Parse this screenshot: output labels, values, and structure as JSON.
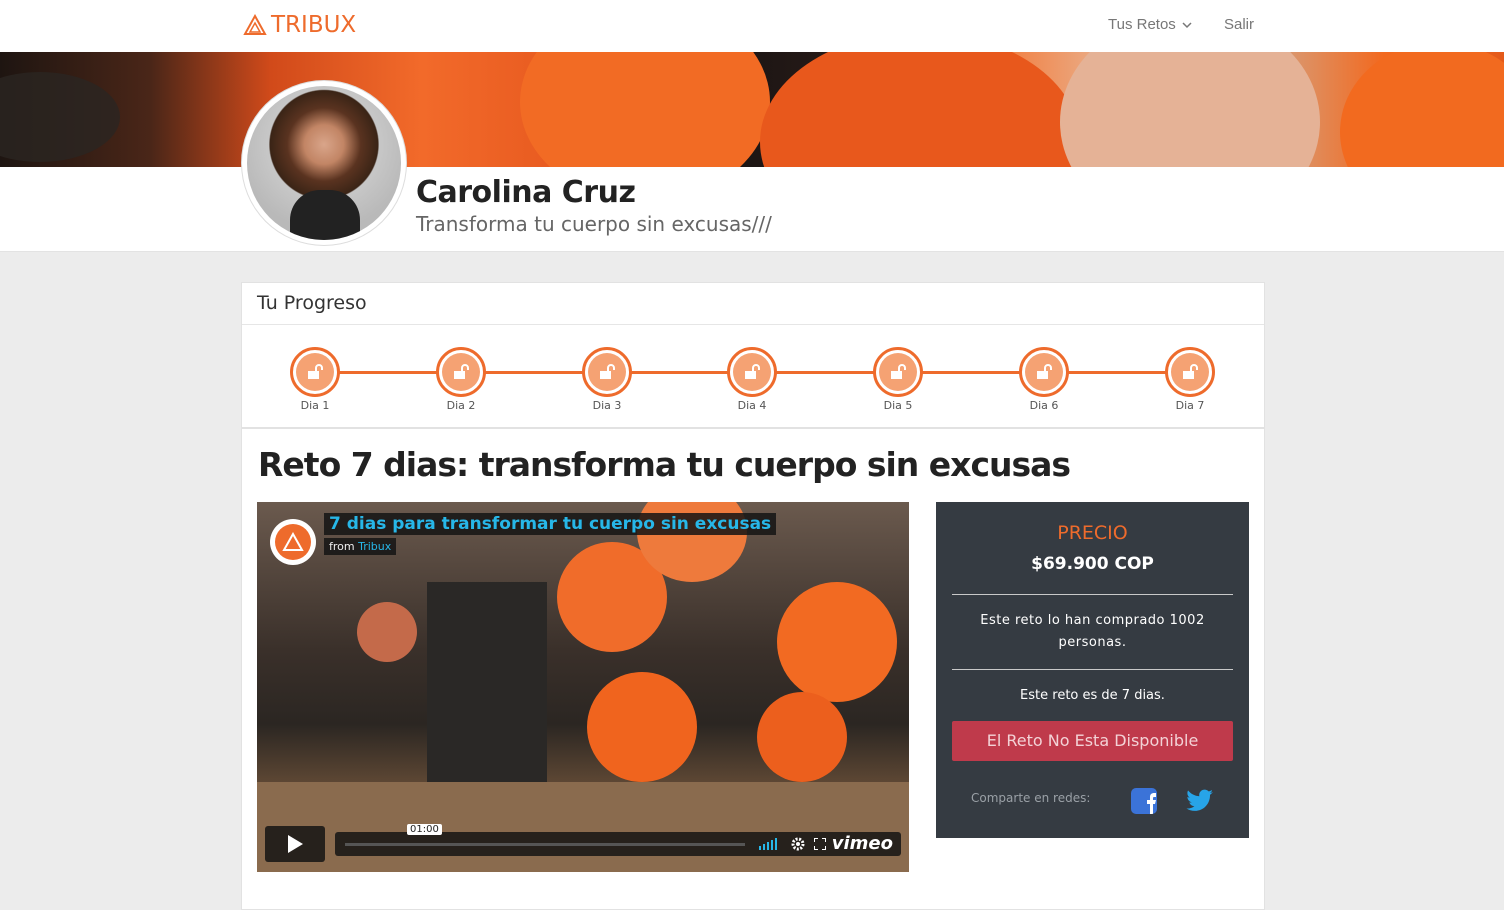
{
  "nav": {
    "brand": "TRIBUX",
    "menu_label": "Tus Retos",
    "logout_label": "Salir"
  },
  "profile": {
    "name": "Carolina Cruz",
    "tagline": "Transforma tu cuerpo sin excusas///"
  },
  "progress": {
    "heading": "Tu Progreso",
    "days": [
      "Dia 1",
      "Dia 2",
      "Dia 3",
      "Dia 4",
      "Dia 5",
      "Dia 6",
      "Dia 7"
    ]
  },
  "challenge": {
    "title": "Reto 7 dias: transforma tu cuerpo sin excusas"
  },
  "video": {
    "title": "7 dias para transformar tu cuerpo sin excusas",
    "from_prefix": "from",
    "from_channel": "Tribux",
    "time": "01:00",
    "player_brand": "vimeo"
  },
  "pricing": {
    "label": "PRECIO",
    "value": "$69.900 COP",
    "purchased_text": "Este reto lo han comprado 1002 personas.",
    "duration_text": "Este reto es de 7 dias.",
    "unavailable_button": "El Reto No Esta Disponible",
    "share_label": "Comparte en redes:"
  },
  "colors": {
    "accent": "#ee6b2c",
    "panel": "#353b42",
    "unavailable": "#bf3a4b",
    "vimeo_blue": "#27b7e8"
  }
}
